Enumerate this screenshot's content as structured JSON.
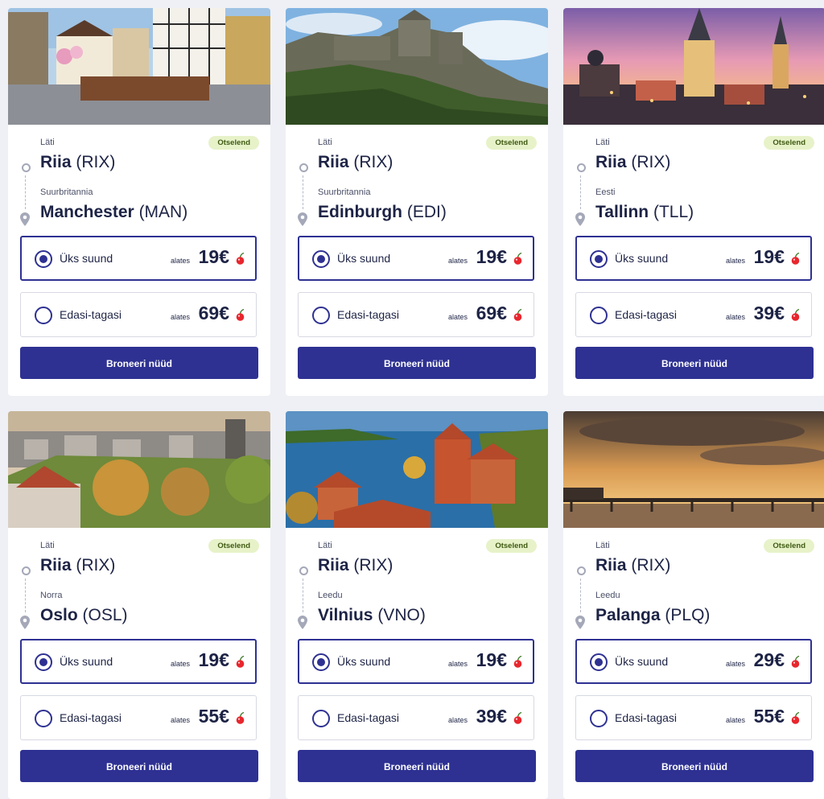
{
  "labels": {
    "badge": "Otselend",
    "one_way": "Üks suund",
    "round_trip": "Edasi-tagasi",
    "from_word": "alates",
    "book": "Broneeri nüüd"
  },
  "colors": {
    "primary": "#2e3192",
    "badge_bg": "#e7f2c9",
    "badge_text": "#3f5a12",
    "cherry": "#e8262d"
  },
  "icons": [
    "origin-dot-icon",
    "destination-pin-icon",
    "cherry-icon",
    "radio-icon"
  ],
  "cards": [
    {
      "photo": "Manchester street square",
      "origin": {
        "country": "Läti",
        "city": "Riia",
        "code": "(RIX)"
      },
      "destination": {
        "country": "Suurbritannia",
        "city": "Manchester",
        "code": "(MAN)"
      },
      "selected_fare": "one_way",
      "one_way_price": "19€",
      "round_trip_price": "69€"
    },
    {
      "photo": "Edinburgh castle",
      "origin": {
        "country": "Läti",
        "city": "Riia",
        "code": "(RIX)"
      },
      "destination": {
        "country": "Suurbritannia",
        "city": "Edinburgh",
        "code": "(EDI)"
      },
      "selected_fare": "one_way",
      "one_way_price": "19€",
      "round_trip_price": "69€"
    },
    {
      "photo": "Tallinn old town at sunset",
      "origin": {
        "country": "Läti",
        "city": "Riia",
        "code": "(RIX)"
      },
      "destination": {
        "country": "Eesti",
        "city": "Tallinn",
        "code": "(TLL)"
      },
      "selected_fare": "one_way",
      "one_way_price": "19€",
      "round_trip_price": "39€"
    },
    {
      "photo": "Oslo cityscape",
      "origin": {
        "country": "Läti",
        "city": "Riia",
        "code": "(RIX)"
      },
      "destination": {
        "country": "Norra",
        "city": "Oslo",
        "code": "(OSL)"
      },
      "selected_fare": "one_way",
      "one_way_price": "19€",
      "round_trip_price": "55€"
    },
    {
      "photo": "Trakai island castle",
      "origin": {
        "country": "Läti",
        "city": "Riia",
        "code": "(RIX)"
      },
      "destination": {
        "country": "Leedu",
        "city": "Vilnius",
        "code": "(VNO)"
      },
      "selected_fare": "one_way",
      "one_way_price": "19€",
      "round_trip_price": "39€"
    },
    {
      "photo": "Palanga pier at sunset",
      "origin": {
        "country": "Läti",
        "city": "Riia",
        "code": "(RIX)"
      },
      "destination": {
        "country": "Leedu",
        "city": "Palanga",
        "code": "(PLQ)"
      },
      "selected_fare": "one_way",
      "one_way_price": "29€",
      "round_trip_price": "55€"
    }
  ]
}
